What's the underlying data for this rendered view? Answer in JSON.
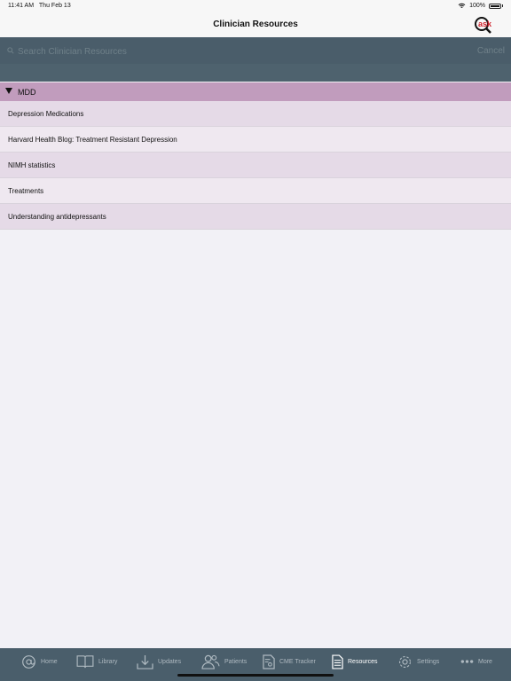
{
  "status_bar": {
    "time": "11:41 AM",
    "date": "Thu Feb 13",
    "battery": "100%",
    "icons": [
      "wifi-icon",
      "battery-icon"
    ]
  },
  "nav": {
    "title": "Clinician Resources",
    "logo_text": "ask"
  },
  "search": {
    "placeholder": "Search Clinician Resources",
    "cancel_label": "Cancel"
  },
  "section": {
    "label": "MDD",
    "expanded": true
  },
  "items": [
    {
      "label": "Depression Medications"
    },
    {
      "label": "Harvard Health Blog: Treatment Resistant Depression"
    },
    {
      "label": "NIMH statistics"
    },
    {
      "label": "Treatments"
    },
    {
      "label": "Understanding antidepressants"
    }
  ],
  "tabs": [
    {
      "label": "Home",
      "icon": "at-icon"
    },
    {
      "label": "Library",
      "icon": "book-icon"
    },
    {
      "label": "Updates",
      "icon": "download-icon"
    },
    {
      "label": "Patients",
      "icon": "people-icon"
    },
    {
      "label": "CME Tracker",
      "icon": "certificate-icon"
    },
    {
      "label": "Resources",
      "icon": "document-icon",
      "active": true
    },
    {
      "label": "Settings",
      "icon": "gear-icon"
    },
    {
      "label": "More",
      "icon": "more-dots-icon"
    }
  ],
  "colors": {
    "header_bar": "#4a5d6a",
    "section_bar": "#c19cbd",
    "row_odd": "#e5dae7",
    "row_even": "#efe8f0",
    "logo_red": "#d0202a"
  }
}
